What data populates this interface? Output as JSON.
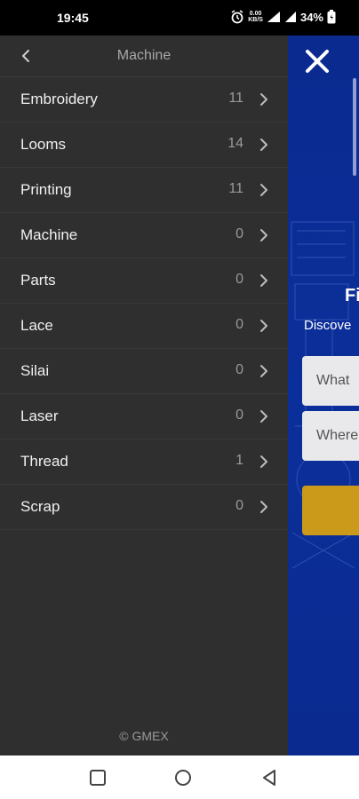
{
  "status_bar": {
    "time": "19:45",
    "net_speed": "0.00",
    "net_unit": "KB/S",
    "battery": "34%"
  },
  "drawer": {
    "title": "Machine",
    "items": [
      {
        "label": "Embroidery",
        "count": "11"
      },
      {
        "label": "Looms",
        "count": "14"
      },
      {
        "label": "Printing",
        "count": "11"
      },
      {
        "label": "Machine",
        "count": "0"
      },
      {
        "label": "Parts",
        "count": "0"
      },
      {
        "label": "Lace",
        "count": "0"
      },
      {
        "label": "Silai",
        "count": "0"
      },
      {
        "label": "Laser",
        "count": "0"
      },
      {
        "label": "Thread",
        "count": "1"
      },
      {
        "label": "Scrap",
        "count": "0"
      }
    ],
    "footer": "© GMEX"
  },
  "background": {
    "heading": "Fi",
    "subtitle": "Discove",
    "field1_placeholder": "What",
    "field2_placeholder": "Where"
  },
  "colors": {
    "drawer_bg": "#2f2f2f",
    "page_bg": "#0a2a8f",
    "accent_button": "#cc9a1a"
  },
  "icons": {
    "back": "chevron-left-icon",
    "item_chevron": "chevron-right-icon",
    "close": "close-icon",
    "nav_recent": "square-icon",
    "nav_home": "circle-icon",
    "nav_back": "triangle-back-icon"
  }
}
